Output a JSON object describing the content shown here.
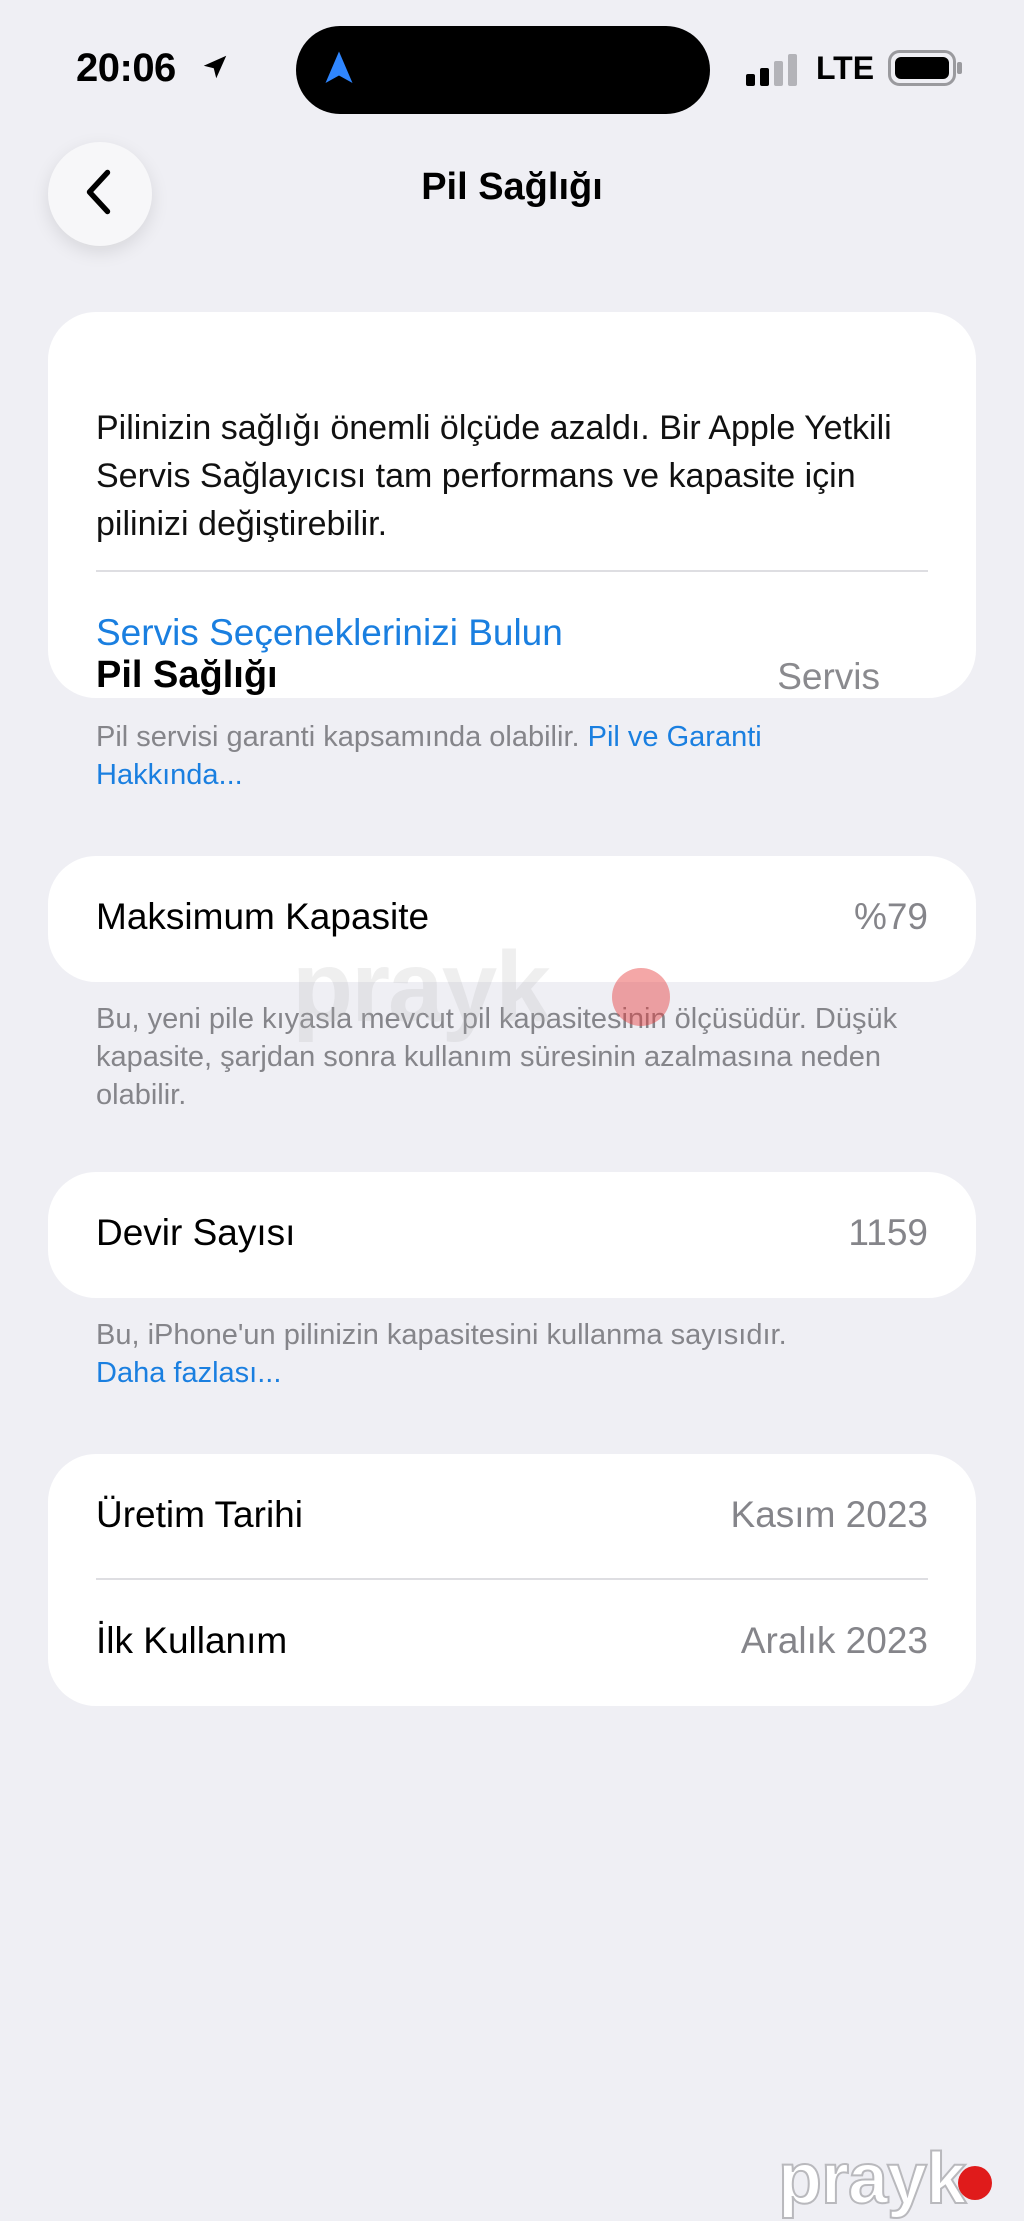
{
  "status_bar": {
    "time": "20:06",
    "network": "LTE",
    "icons": [
      "location-arrow-icon",
      "navigation-icon",
      "signal-icon",
      "battery-icon"
    ]
  },
  "nav": {
    "title": "Pil Sağlığı",
    "back_icon": "chevron-left-icon"
  },
  "battery_health": {
    "title": "Pil Sağlığı",
    "status": "Servis",
    "description": "Pilinizin sağlığı önemli ölçüde azaldı. Bir Apple Yetkili Servis Sağlayıcısı tam performans ve kapasite için pilinizi değiştirebilir.",
    "link": "Servis Seçeneklerinizi Bulun",
    "footer_text": "Pil servisi garanti kapsamında olabilir.",
    "footer_link": "Pil ve Garanti Hakkında..."
  },
  "max_capacity": {
    "label": "Maksimum Kapasite",
    "value": "%79",
    "footer": "Bu, yeni pile kıyasla mevcut pil kapasitesinin ölçüsüdür. Düşük kapasite, şarjdan sonra kullanım süresinin azalmasına neden olabilir."
  },
  "cycle_count": {
    "label": "Devir Sayısı",
    "value": "1159",
    "footer_text": "Bu, iPhone'un pilinizin kapasitesini kullanma sayısıdır.",
    "footer_link": "Daha fazlası..."
  },
  "dates": {
    "manufacture_label": "Üretim Tarihi",
    "manufacture_value": "Kasım 2023",
    "first_use_label": "İlk Kullanım",
    "first_use_value": "Aralık 2023"
  },
  "watermark": "prayk",
  "colors": {
    "background": "#efeff4",
    "link": "#1a7fe0",
    "secondary_text": "#85858a"
  }
}
